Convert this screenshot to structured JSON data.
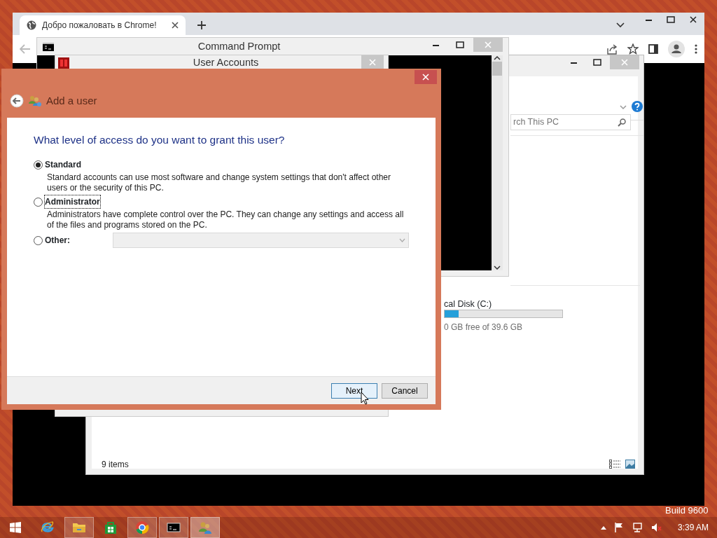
{
  "desktop": {
    "build_text": "Build 9600"
  },
  "browser": {
    "tabs": [
      {
        "title": "Добро пожаловать в Chrome!",
        "selected": true
      }
    ]
  },
  "explorer": {
    "search": {
      "placeholder": "rch This PC"
    },
    "drive": {
      "name": "cal Disk (C:)",
      "level": 0.12,
      "free_text": "0 GB free of 39.6 GB"
    },
    "status_bar": "9 items"
  },
  "command_prompt": {
    "title": "Command Prompt"
  },
  "user_accounts": {
    "title": "User Accounts"
  },
  "dialog": {
    "title": "Add a user",
    "question": "What level of access do you want to grant this user?",
    "options": [
      {
        "kind": "described",
        "label": "Standard",
        "selected": true,
        "focused": false,
        "description": "Standard accounts can use most software and change system settings that don't affect other users or the security of this PC."
      },
      {
        "kind": "described",
        "label": "Administrator",
        "selected": false,
        "focused": true,
        "description": "Administrators have complete control over the PC. They can change any settings and access all of the files and programs stored on the PC."
      },
      {
        "kind": "dropdown",
        "label": "Other:",
        "selected": false,
        "focused": false,
        "disabled": true
      }
    ],
    "buttons": [
      {
        "label": "Next",
        "default": true
      },
      {
        "label": "Cancel",
        "default": false
      }
    ]
  },
  "taskbar": {
    "apps": [
      {
        "kind": "ie",
        "running": false,
        "selected": false
      },
      {
        "kind": "explorer",
        "running": true,
        "selected": false
      },
      {
        "kind": "store",
        "running": false,
        "selected": false
      },
      {
        "kind": "chrome",
        "running": true,
        "selected": false
      },
      {
        "kind": "cmd",
        "running": true,
        "selected": false
      },
      {
        "kind": "users",
        "running": true,
        "selected": true
      }
    ],
    "clock": "3:39 AM"
  }
}
